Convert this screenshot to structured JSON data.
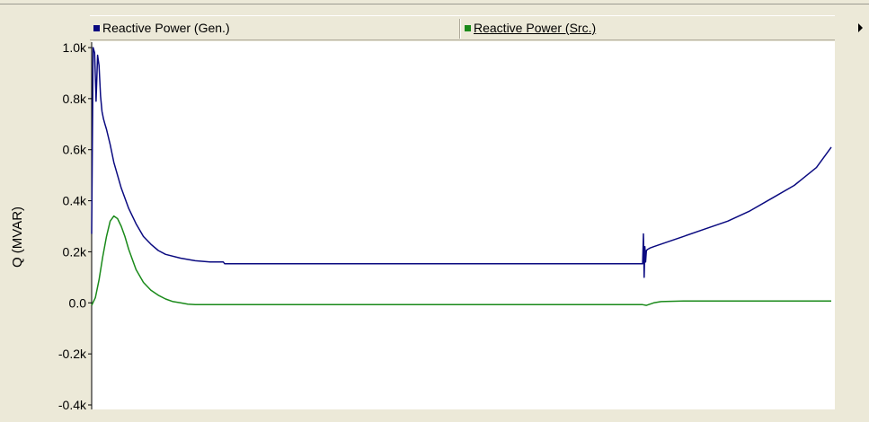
{
  "chart_data": {
    "type": "line",
    "ylabel": "Q (MVAR)",
    "ylim": [
      -0.4,
      1.0
    ],
    "xlim": [
      0,
      1
    ],
    "yticks": [
      "1.0k",
      "0.8k",
      "0.6k",
      "0.4k",
      "0.2k",
      "0.0",
      "-0.2k",
      "-0.4k"
    ],
    "ytick_values": [
      1.0,
      0.8,
      0.6,
      0.4,
      0.2,
      0.0,
      -0.2,
      -0.4
    ],
    "legend_placement": "top",
    "grid": false,
    "series": [
      {
        "name": "Reactive Power (Gen.)",
        "color": "#0a0a80",
        "x": [
          0.0,
          0.002,
          0.004,
          0.006,
          0.008,
          0.01,
          0.012,
          0.014,
          0.016,
          0.018,
          0.02,
          0.025,
          0.03,
          0.04,
          0.05,
          0.06,
          0.07,
          0.08,
          0.09,
          0.1,
          0.12,
          0.14,
          0.16,
          0.178,
          0.18,
          0.3,
          0.5,
          0.7,
          0.745,
          0.746,
          0.747,
          0.748,
          0.749,
          0.75,
          0.752,
          0.755,
          0.76,
          0.78,
          0.8,
          0.83,
          0.86,
          0.89,
          0.92,
          0.95,
          0.98,
          1.0
        ],
        "values": [
          0.27,
          1.0,
          0.98,
          0.79,
          0.97,
          0.93,
          0.81,
          0.75,
          0.72,
          0.7,
          0.68,
          0.62,
          0.55,
          0.45,
          0.37,
          0.31,
          0.26,
          0.23,
          0.205,
          0.19,
          0.175,
          0.165,
          0.16,
          0.16,
          0.153,
          0.153,
          0.153,
          0.153,
          0.153,
          0.27,
          0.1,
          0.22,
          0.16,
          0.205,
          0.21,
          0.215,
          0.22,
          0.24,
          0.26,
          0.29,
          0.32,
          0.36,
          0.41,
          0.46,
          0.53,
          0.61
        ]
      },
      {
        "name": "Reactive Power (Src.)",
        "color": "#1a8a1a",
        "x": [
          0.0,
          0.005,
          0.01,
          0.015,
          0.02,
          0.025,
          0.03,
          0.035,
          0.04,
          0.045,
          0.05,
          0.055,
          0.06,
          0.07,
          0.08,
          0.09,
          0.1,
          0.11,
          0.12,
          0.13,
          0.14,
          0.2,
          0.4,
          0.6,
          0.745,
          0.75,
          0.76,
          0.77,
          0.8,
          0.9,
          1.0
        ],
        "values": [
          -0.01,
          0.02,
          0.09,
          0.18,
          0.26,
          0.32,
          0.34,
          0.33,
          0.3,
          0.26,
          0.21,
          0.17,
          0.13,
          0.08,
          0.05,
          0.03,
          0.015,
          0.005,
          0.0,
          -0.005,
          -0.007,
          -0.007,
          -0.007,
          -0.007,
          -0.007,
          -0.01,
          0.0,
          0.005,
          0.007,
          0.007,
          0.007
        ]
      }
    ]
  }
}
